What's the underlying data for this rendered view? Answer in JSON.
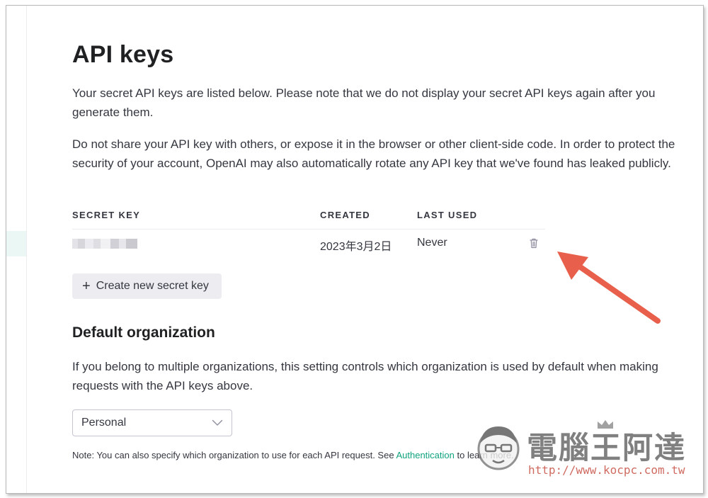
{
  "page": {
    "title": "API keys",
    "intro": "Your secret API keys are listed below. Please note that we do not display your secret API keys again after you generate them.",
    "warning": "Do not share your API key with others, or expose it in the browser or other client-side code. In order to protect the security of your account, OpenAI may also automatically rotate any API key that we've found has leaked publicly."
  },
  "keys_table": {
    "headers": {
      "secret_key": "SECRET KEY",
      "created": "CREATED",
      "last_used": "LAST USED"
    },
    "rows": [
      {
        "secret_key": "",
        "created": "2023年3月2日",
        "last_used": "Never"
      }
    ]
  },
  "create_button": {
    "plus": "+",
    "label": "Create new secret key"
  },
  "org": {
    "heading": "Default organization",
    "description": "If you belong to multiple organizations, this setting controls which organization is used by default when making requests with the API keys above.",
    "selected": "Personal",
    "note_prefix": "Note: You can also specify which organization to use for each API request. See ",
    "note_link": "Authentication",
    "note_suffix": " to learn more."
  },
  "watermark": {
    "brand": "電腦王阿達",
    "url": "http://www.kocpc.com.tw"
  },
  "colors": {
    "accent": "#10a37f",
    "annotation_arrow": "#e8604c",
    "button_bg": "#ececf1"
  },
  "icons": {
    "delete": "trash-icon",
    "dropdown": "chevron-down-icon",
    "annotation": "arrow-annotation"
  }
}
